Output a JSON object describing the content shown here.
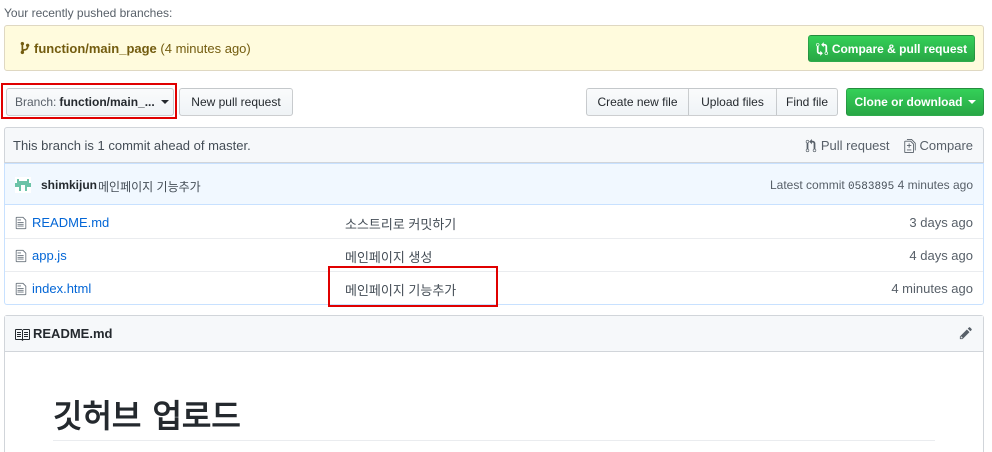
{
  "recent": {
    "heading": "Your recently pushed branches:",
    "branch_name": "function/main_page",
    "branch_age": "(4 minutes ago)",
    "compare_button": "Compare & pull request"
  },
  "toolbar": {
    "branch_label": "Branch:",
    "branch_value": "function/main_...",
    "new_pr": "New pull request",
    "create_file": "Create new file",
    "upload_files": "Upload files",
    "find_file": "Find file",
    "clone": "Clone or download"
  },
  "tease": {
    "ahead_text": "This branch is 1 commit ahead of master.",
    "pull_request": "Pull request",
    "compare": "Compare"
  },
  "latest_commit": {
    "author": "shimkijun",
    "message": "메인페이지 기능추가",
    "label": "Latest commit",
    "sha": "0583895",
    "age": "4 minutes ago"
  },
  "files": [
    {
      "name": "README.md",
      "message": "소스트리로 커밋하기",
      "age": "3 days ago"
    },
    {
      "name": "app.js",
      "message": "메인페이지 생성",
      "age": "4 days ago"
    },
    {
      "name": "index.html",
      "message": "메인페이지 기능추가",
      "age": "4 minutes ago"
    }
  ],
  "readme": {
    "title": "README.md",
    "heading": "깃허브 업로드"
  },
  "colors": {
    "accent_green": "#28a745",
    "link_blue": "#0366d6",
    "highlight_red": "#e00000",
    "recent_bg": "#fffbdd"
  },
  "icons": [
    "branch-icon",
    "pull-request-icon",
    "compare-icon",
    "file-icon",
    "book-icon",
    "pencil-icon",
    "avatar"
  ]
}
